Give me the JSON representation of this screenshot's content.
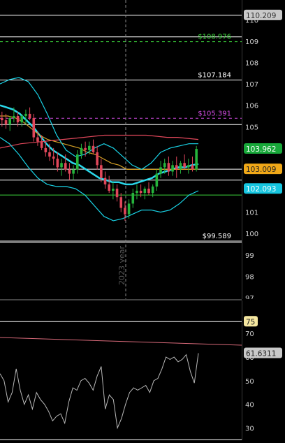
{
  "colors": {
    "background": "#000000",
    "candle_up": "#26b43c",
    "candle_down": "#e0475a",
    "bollinger": "#19d3e6",
    "ma_fast": "#2ad8ea",
    "ma_slow": "#d8a326",
    "ma_long": "#e0475a",
    "ma_green": "#21b04a",
    "rsi_line": "#b8b8b8",
    "level_white": "#ffffff",
    "level_green": "#3ad13a",
    "level_magenta": "#d04be0",
    "badge_green": "#18a83a",
    "badge_orange": "#f0a818",
    "badge_cyan": "#16c6e0",
    "badge_gray": "#c9c9c9",
    "badge_yellow": "#f5e7a0"
  },
  "price_pane": {
    "vertical_marker_label": "2023 year",
    "level_labels": {
      "green_top": "$108.976",
      "white_mid": "$107.184",
      "magenta": "$105.391",
      "white_bottom": "$99.589"
    },
    "axis_badges": {
      "top": "110.209",
      "green": "103.962",
      "orange": "103.009",
      "cyan": "102.093"
    }
  },
  "rsi_pane": {
    "axis_badges": {
      "overbought": "75",
      "current": "61.6311"
    }
  },
  "chart_data": [
    {
      "type": "candlestick",
      "title": "",
      "ylim": [
        97,
        110.5
      ],
      "y_ticks": [
        97,
        98,
        99,
        100,
        101,
        102,
        103,
        104,
        105,
        106,
        107,
        108,
        109,
        110
      ],
      "horizontal_levels": [
        {
          "value": 110.209,
          "color": "white",
          "style": "solid"
        },
        {
          "value": 108.976,
          "color": "green",
          "style": "dashed",
          "label": "$108.976"
        },
        {
          "value": 109.2,
          "color": "white",
          "style": "solid"
        },
        {
          "value": 107.184,
          "color": "white",
          "style": "solid",
          "label": "$107.184"
        },
        {
          "value": 105.391,
          "color": "magenta",
          "style": "dashed",
          "label": "$105.391"
        },
        {
          "value": 105.1,
          "color": "white",
          "style": "solid"
        },
        {
          "value": 103.009,
          "color": "white",
          "style": "solid"
        },
        {
          "value": 102.5,
          "color": "white",
          "style": "solid"
        },
        {
          "value": 101.8,
          "color": "green",
          "style": "solid"
        },
        {
          "value": 99.589,
          "color": "white",
          "style": "solid",
          "label": "$99.589"
        }
      ],
      "candles": [
        [
          105.4,
          105.7,
          105.0,
          105.3
        ],
        [
          105.3,
          105.6,
          104.9,
          105.1
        ],
        [
          105.1,
          105.5,
          104.8,
          105.4
        ],
        [
          105.4,
          105.9,
          105.2,
          105.5
        ],
        [
          105.5,
          105.7,
          105.0,
          105.2
        ],
        [
          105.2,
          105.6,
          105.0,
          105.5
        ],
        [
          105.5,
          105.8,
          105.1,
          105.6
        ],
        [
          105.6,
          105.9,
          105.3,
          105.4
        ],
        [
          105.4,
          105.6,
          104.3,
          104.5
        ],
        [
          104.5,
          104.8,
          104.1,
          104.3
        ],
        [
          104.3,
          104.6,
          103.9,
          104.0
        ],
        [
          104.0,
          104.3,
          103.6,
          103.8
        ],
        [
          103.8,
          104.2,
          103.4,
          103.6
        ],
        [
          103.6,
          104.0,
          103.2,
          103.5
        ],
        [
          103.5,
          103.8,
          102.9,
          103.1
        ],
        [
          103.1,
          103.5,
          102.7,
          103.3
        ],
        [
          103.3,
          103.7,
          102.9,
          103.0
        ],
        [
          103.0,
          103.3,
          102.5,
          102.8
        ],
        [
          102.8,
          103.2,
          102.5,
          103.0
        ],
        [
          103.0,
          103.9,
          102.8,
          103.7
        ],
        [
          103.7,
          104.2,
          103.5,
          104.0
        ],
        [
          104.0,
          104.3,
          103.6,
          103.9
        ],
        [
          103.9,
          104.3,
          103.7,
          104.1
        ],
        [
          104.1,
          104.4,
          103.7,
          103.8
        ],
        [
          103.8,
          104.1,
          103.0,
          103.2
        ],
        [
          103.2,
          103.5,
          102.4,
          102.6
        ],
        [
          102.6,
          102.9,
          102.1,
          102.3
        ],
        [
          102.3,
          102.7,
          101.9,
          102.0
        ],
        [
          102.0,
          102.4,
          101.6,
          102.1
        ],
        [
          102.1,
          102.3,
          101.5,
          101.7
        ],
        [
          101.7,
          101.9,
          101.0,
          101.2
        ],
        [
          101.2,
          101.5,
          100.6,
          100.9
        ],
        [
          100.9,
          101.6,
          100.7,
          101.4
        ],
        [
          101.4,
          102.1,
          101.2,
          101.9
        ],
        [
          101.9,
          102.3,
          101.6,
          102.0
        ],
        [
          102.0,
          102.3,
          101.7,
          101.9
        ],
        [
          101.9,
          102.2,
          101.6,
          102.1
        ],
        [
          102.1,
          102.4,
          101.8,
          101.9
        ],
        [
          101.9,
          102.3,
          101.7,
          102.2
        ],
        [
          102.2,
          103.0,
          102.0,
          102.8
        ],
        [
          102.8,
          103.4,
          102.6,
          103.1
        ],
        [
          103.1,
          103.5,
          102.8,
          103.3
        ],
        [
          103.3,
          103.6,
          102.7,
          102.9
        ],
        [
          102.9,
          103.4,
          102.7,
          103.2
        ],
        [
          103.2,
          103.6,
          102.6,
          103.0
        ],
        [
          103.0,
          103.4,
          102.8,
          103.3
        ],
        [
          103.3,
          103.7,
          103.0,
          103.1
        ],
        [
          103.1,
          103.5,
          102.8,
          103.2
        ],
        [
          103.2,
          103.6,
          102.9,
          103.0
        ],
        [
          103.0,
          104.1,
          102.9,
          103.96
        ]
      ],
      "series": [
        {
          "values": [
            106.0,
            105.9,
            105.8,
            105.6,
            105.3,
            105.0,
            104.6,
            104.2,
            103.9,
            103.7,
            103.5,
            103.3,
            103.2,
            103.0,
            102.8,
            102.6,
            102.5,
            102.4,
            102.4,
            102.3,
            102.3,
            102.4,
            102.5,
            102.6,
            102.8,
            102.9,
            103.0,
            103.1,
            103.1,
            103.2,
            103.25
          ]
        },
        {
          "values": [
            105.5,
            105.5,
            105.4,
            105.2,
            104.9,
            104.6,
            104.4,
            104.3,
            104.2,
            104.1,
            104.0,
            103.8,
            103.7,
            103.5,
            103.3,
            103.2,
            103.0,
            103.0,
            103.0,
            103.0,
            103.0,
            103.0,
            103.0,
            103.0,
            103.0,
            103.01
          ]
        },
        {
          "values": [
            104.0,
            104.1,
            104.2,
            104.25,
            104.3,
            104.35,
            104.4,
            104.45,
            104.5,
            104.55,
            104.6,
            104.6,
            104.6,
            104.6,
            104.6,
            104.55,
            104.5,
            104.5,
            104.45,
            104.4
          ]
        },
        {
          "values": [
            107.0,
            107.2,
            107.3,
            107.1,
            106.5,
            105.6,
            104.6,
            103.9,
            103.6,
            103.7,
            104.0,
            104.2,
            104.0,
            103.6,
            103.2,
            103.0,
            103.3,
            103.8,
            104.0,
            104.1,
            104.2,
            104.2
          ]
        },
        {
          "values": [
            104.5,
            104.2,
            103.7,
            103.1,
            102.6,
            102.3,
            102.2,
            102.2,
            102.1,
            101.8,
            101.3,
            100.8,
            100.6,
            100.7,
            100.9,
            101.1,
            101.1,
            101.0,
            101.1,
            101.4,
            101.8,
            102.0
          ]
        }
      ]
    },
    {
      "type": "line",
      "title": "",
      "ylim": [
        26,
        81
      ],
      "y_ticks": [
        30,
        40,
        50,
        60,
        70
      ],
      "horizontal_levels": [
        {
          "value": 75,
          "color": "white"
        },
        {
          "value": 66.5,
          "color": "pink"
        },
        {
          "value": 25,
          "color": "white"
        }
      ],
      "values": [
        53,
        50,
        41,
        45,
        55,
        46,
        40,
        44,
        38,
        45,
        42,
        40,
        37,
        33,
        35,
        36,
        32,
        41,
        47,
        46,
        50,
        51,
        49,
        46,
        52,
        56,
        38,
        44,
        42,
        30,
        34,
        40,
        45,
        47,
        46,
        47,
        48,
        45,
        50,
        51,
        55,
        60,
        59,
        60,
        58,
        59,
        61,
        54,
        49,
        61.63
      ]
    }
  ]
}
